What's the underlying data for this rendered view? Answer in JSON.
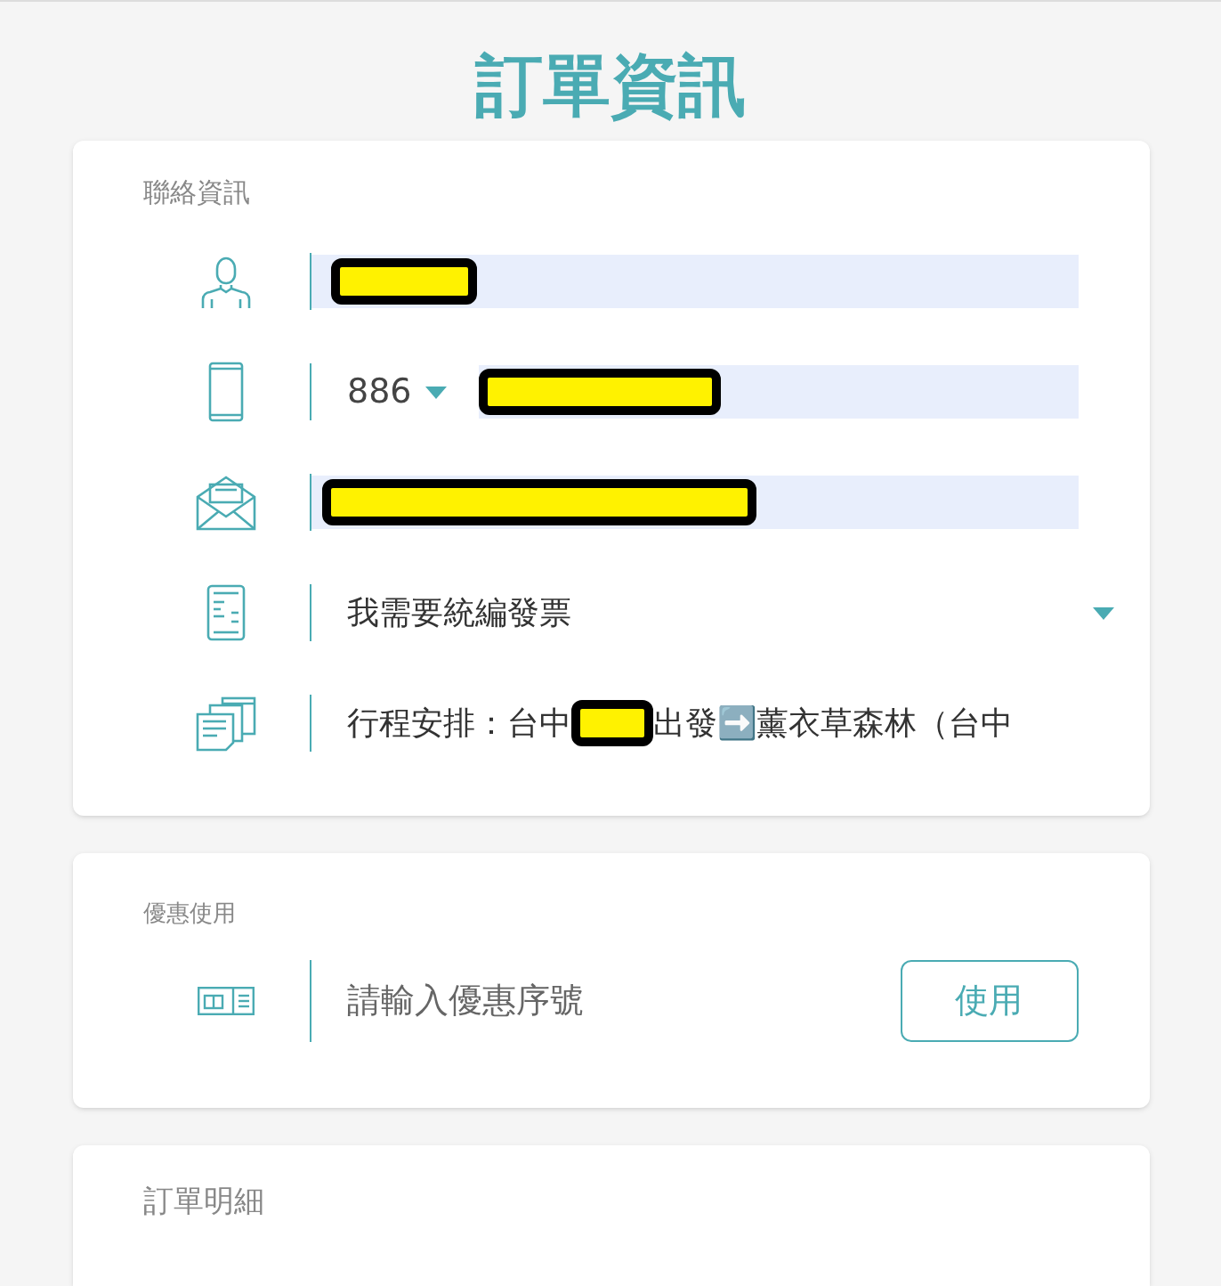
{
  "title": "訂單資訊",
  "contact": {
    "heading": "聯絡資訊",
    "rows": [
      {
        "kind": "name",
        "redacted": true
      },
      {
        "kind": "phone",
        "country_code": "886",
        "redacted": true
      },
      {
        "kind": "email",
        "redacted": true
      },
      {
        "kind": "invoice",
        "value": "我需要統編發票"
      },
      {
        "kind": "itinerary",
        "text_before": "行程安排：台中",
        "text_after": "出發➡️薰衣草森林（台中"
      }
    ]
  },
  "coupon": {
    "heading": "優惠使用",
    "placeholder": "請輸入優惠序號",
    "button": "使用"
  },
  "order_details": {
    "heading": "訂單明細"
  }
}
